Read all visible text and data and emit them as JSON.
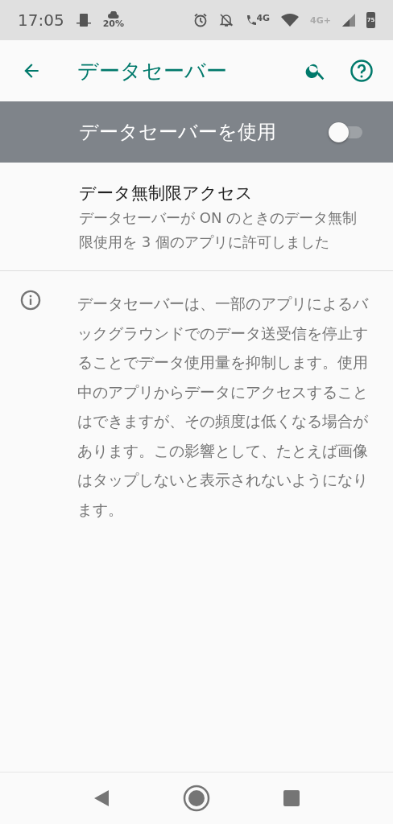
{
  "status_bar": {
    "time": "17:05",
    "weather": "20%",
    "call_network": "4G",
    "network": "4G+",
    "battery": "75"
  },
  "toolbar": {
    "title": "データセーバー"
  },
  "master_switch": {
    "label": "データセーバーを使用",
    "on": false
  },
  "items": [
    {
      "title": "データ無制限アクセス",
      "summary": "データセーバーが ON のときのデータ無制限使用を 3 個のアプリに許可しました"
    }
  ],
  "footer_info": "データセーバーは、一部のアプリによるバックグラウンドでのデータ送受信を停止することでデータ使用量を抑制します。使用中のアプリからデータにアクセスすることはできますが、その頻度は低くなる場合があります。この影響として、たとえば画像はタップしないと表示されないようになります。"
}
